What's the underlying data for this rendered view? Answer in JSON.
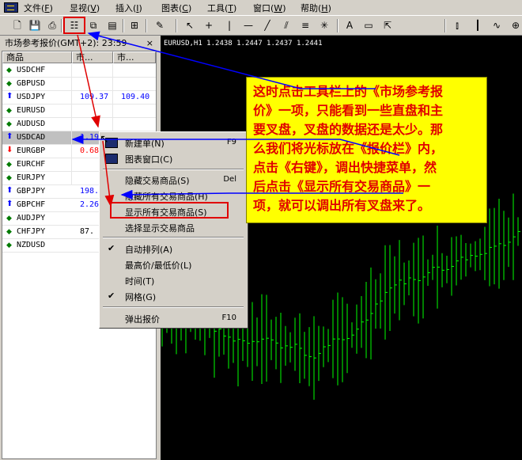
{
  "menu": [
    {
      "label": "文件",
      "key": "F"
    },
    {
      "label": "显视",
      "key": "V"
    },
    {
      "label": "插入",
      "key": "I"
    },
    {
      "label": "图表",
      "key": "C"
    },
    {
      "label": "工具",
      "key": "T"
    },
    {
      "label": "窗口",
      "key": "W"
    },
    {
      "label": "帮助",
      "key": "H"
    }
  ],
  "panel": {
    "title": "市场参考报价(GMT+2): 23:59",
    "close": "×",
    "headers": [
      "商品",
      "市...",
      "市..."
    ],
    "rows": [
      {
        "symbol": "USDCHF",
        "indicator": "dot",
        "bid": "",
        "ask": ""
      },
      {
        "symbol": "GBPUSD",
        "indicator": "dot",
        "bid": "",
        "ask": ""
      },
      {
        "symbol": "USDJPY",
        "indicator": "up",
        "bid": "109.37",
        "ask": "109.40"
      },
      {
        "symbol": "EURUSD",
        "indicator": "dot",
        "bid": "",
        "ask": ""
      },
      {
        "symbol": "AUDUSD",
        "indicator": "dot",
        "bid": "",
        "ask": ""
      },
      {
        "symbol": "USDCAD",
        "indicator": "up",
        "bid": "1.19",
        "ask": "",
        "selected": true
      },
      {
        "symbol": "EURGBP",
        "indicator": "down",
        "bid": "0.68",
        "ask": ""
      },
      {
        "symbol": "EURCHF",
        "indicator": "dot",
        "bid": "",
        "ask": ""
      },
      {
        "symbol": "EURJPY",
        "indicator": "dot",
        "bid": "",
        "ask": ""
      },
      {
        "symbol": "GBPJPY",
        "indicator": "up",
        "bid": "198.",
        "ask": ""
      },
      {
        "symbol": "GBPCHF",
        "indicator": "up",
        "bid": "2.26",
        "ask": ""
      },
      {
        "symbol": "AUDJPY",
        "indicator": "dot",
        "bid": "",
        "ask": ""
      },
      {
        "symbol": "CHFJPY",
        "indicator": "dot",
        "bid": "87.",
        "ask": ""
      },
      {
        "symbol": "NZDUSD",
        "indicator": "dot",
        "bid": "",
        "ask": ""
      }
    ]
  },
  "chart": {
    "title": "EURUSD,H1  1.2438 1.2447 1.2437 1.2441",
    "candle_color": "#00ff00"
  },
  "context_menu": {
    "items": [
      {
        "label": "新建单(N)",
        "shortcut": "F9",
        "icon": "new-order-icon"
      },
      {
        "label": "图表窗口(C)",
        "shortcut": "",
        "icon": "chart-window-icon"
      },
      {
        "label": "隐藏交易商品(S)",
        "shortcut": "Del"
      },
      {
        "label": "隐藏所有交易商品(H)",
        "shortcut": ""
      },
      {
        "label": "显示所有交易商品(S)",
        "shortcut": ""
      },
      {
        "label": "选择显示交易商品",
        "shortcut": ""
      },
      {
        "label": "自动排列(A)",
        "shortcut": "",
        "checked": true
      },
      {
        "label": "最高价/最低价(L)",
        "shortcut": ""
      },
      {
        "label": "时间(T)",
        "shortcut": ""
      },
      {
        "label": "网格(G)",
        "shortcut": "",
        "checked": true
      },
      {
        "label": "弹出报价",
        "shortcut": "F10"
      }
    ]
  },
  "callout": {
    "text_line1": "这时点击工具栏上的《市场参考报",
    "text_line2": "价》一项，只能看到一些直盘和主",
    "text_line3": "要叉盘，叉盘的数据还是太少。那",
    "text_line4": "么我们将光标放在《报价栏》内，",
    "text_line5": "点击《右键》，调出快捷菜单，然",
    "text_line6": "后点击《显示所有交易商品》一",
    "text_line7": "项，就可以调出所有叉盘来了。"
  },
  "colors": {
    "annotation_red": "#e00000",
    "annotation_blue": "#0000ff",
    "callout_bg": "#ffff00"
  }
}
